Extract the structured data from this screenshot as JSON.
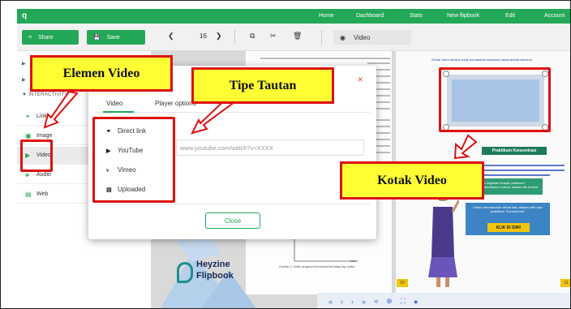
{
  "topnav": {
    "logo": "q",
    "items": [
      "Home",
      "Dashboard",
      "Stats",
      "New flipbook",
      "Edit",
      "Account"
    ]
  },
  "toolbar": {
    "share_label": "Share",
    "save_label": "Save",
    "zoom_value": "16",
    "video_label": "Video"
  },
  "sidebar": {
    "section_header": "INTERACTIVITY",
    "items": [
      {
        "label": "Link",
        "icon": "link-icon"
      },
      {
        "label": "Image",
        "icon": "image-icon"
      },
      {
        "label": "Video",
        "icon": "play-icon"
      },
      {
        "label": "Audio",
        "icon": "speaker-icon"
      },
      {
        "label": "Web",
        "icon": "web-icon"
      }
    ]
  },
  "modal": {
    "tabs": [
      "Video",
      "Player options"
    ],
    "options": [
      {
        "label": "Direct link",
        "icon": "link-icon"
      },
      {
        "label": "YouTube",
        "icon": "youtube-icon"
      },
      {
        "label": "Vimeo",
        "icon": "vimeo-icon"
      },
      {
        "label": "Uploaded",
        "icon": "upload-icon"
      }
    ],
    "url_placeholder": "www.youtube.com/watch?v=XXXX",
    "close_label": "Close"
  },
  "flipbook": {
    "brand_line1": "Heyzine",
    "brand_line2": "Flipbook",
    "right_page_heading": "Simak video berikut untuk menambah wawasan siswa terkait sebelum",
    "banner": "Praktikum Konsentrasi",
    "box1": "Untuk melakukan kegiatan belajar praktikum menggunakan laboratorium virtual, silakan klik tombol di bawah ini!",
    "box2": "Dalam laboratorium virtual kita, silakan pilih opsi praktikum \"Konsentrasi\"",
    "klik": "KLIK DI SINI!",
    "page_left": "10",
    "page_right": "11",
    "chart_caption": "Gambar 3. Grafik pengaruh konsentrasi terhadap laju reaksi",
    "chart_axis": "waktu"
  },
  "annotations": {
    "elemen_video": "Elemen Video",
    "tipe_tautan": "Tipe Tautan",
    "kotak_video": "Kotak Video"
  },
  "colors": {
    "brand_green": "#23a857",
    "callout_fill": "#ffff33",
    "callout_border": "#dd1111"
  }
}
